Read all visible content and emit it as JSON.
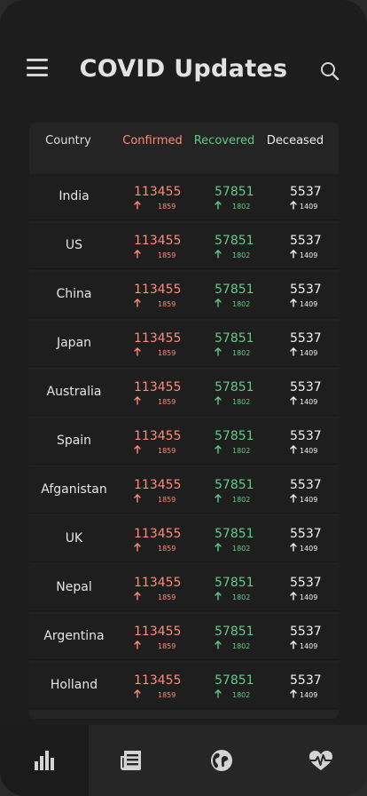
{
  "header": {
    "title": "COVID Updates"
  },
  "table": {
    "columns": {
      "country": "Country",
      "confirmed": "Confirmed",
      "recovered": "Recovered",
      "deceased": "Deceased"
    },
    "rows": [
      {
        "country": "India",
        "confirmed": "113455",
        "confirmed_delta": "1859",
        "recovered": "57851",
        "recovered_delta": "1802",
        "deceased": "5537",
        "deceased_delta": "1409"
      },
      {
        "country": "US",
        "confirmed": "113455",
        "confirmed_delta": "1859",
        "recovered": "57851",
        "recovered_delta": "1802",
        "deceased": "5537",
        "deceased_delta": "1409"
      },
      {
        "country": "China",
        "confirmed": "113455",
        "confirmed_delta": "1859",
        "recovered": "57851",
        "recovered_delta": "1802",
        "deceased": "5537",
        "deceased_delta": "1409"
      },
      {
        "country": "Japan",
        "confirmed": "113455",
        "confirmed_delta": "1859",
        "recovered": "57851",
        "recovered_delta": "1802",
        "deceased": "5537",
        "deceased_delta": "1409"
      },
      {
        "country": "Australia",
        "confirmed": "113455",
        "confirmed_delta": "1859",
        "recovered": "57851",
        "recovered_delta": "1802",
        "deceased": "5537",
        "deceased_delta": "1409"
      },
      {
        "country": "Spain",
        "confirmed": "113455",
        "confirmed_delta": "1859",
        "recovered": "57851",
        "recovered_delta": "1802",
        "deceased": "5537",
        "deceased_delta": "1409"
      },
      {
        "country": "Afganistan",
        "confirmed": "113455",
        "confirmed_delta": "1859",
        "recovered": "57851",
        "recovered_delta": "1802",
        "deceased": "5537",
        "deceased_delta": "1409"
      },
      {
        "country": "UK",
        "confirmed": "113455",
        "confirmed_delta": "1859",
        "recovered": "57851",
        "recovered_delta": "1802",
        "deceased": "5537",
        "deceased_delta": "1409"
      },
      {
        "country": "Nepal",
        "confirmed": "113455",
        "confirmed_delta": "1859",
        "recovered": "57851",
        "recovered_delta": "1802",
        "deceased": "5537",
        "deceased_delta": "1409"
      },
      {
        "country": "Argentina",
        "confirmed": "113455",
        "confirmed_delta": "1859",
        "recovered": "57851",
        "recovered_delta": "1802",
        "deceased": "5537",
        "deceased_delta": "1409"
      },
      {
        "country": "Holland",
        "confirmed": "113455",
        "confirmed_delta": "1859",
        "recovered": "57851",
        "recovered_delta": "1802",
        "deceased": "5537",
        "deceased_delta": "1409"
      }
    ]
  },
  "icons": {
    "menu": "menu-icon",
    "search": "search-icon",
    "up_arrow": "arrow-up-icon",
    "nav": [
      "bar-chart-icon",
      "newspaper-icon",
      "globe-icon",
      "heart-pulse-icon"
    ]
  },
  "colors": {
    "background": "#1d1d1d",
    "card": "#242424",
    "confirmed": "#ff8a78",
    "recovered": "#63c98a",
    "deceased": "#f2f2f2",
    "active_nav": "#1b1b1b"
  },
  "bottom_nav": {
    "active_index": 0
  }
}
